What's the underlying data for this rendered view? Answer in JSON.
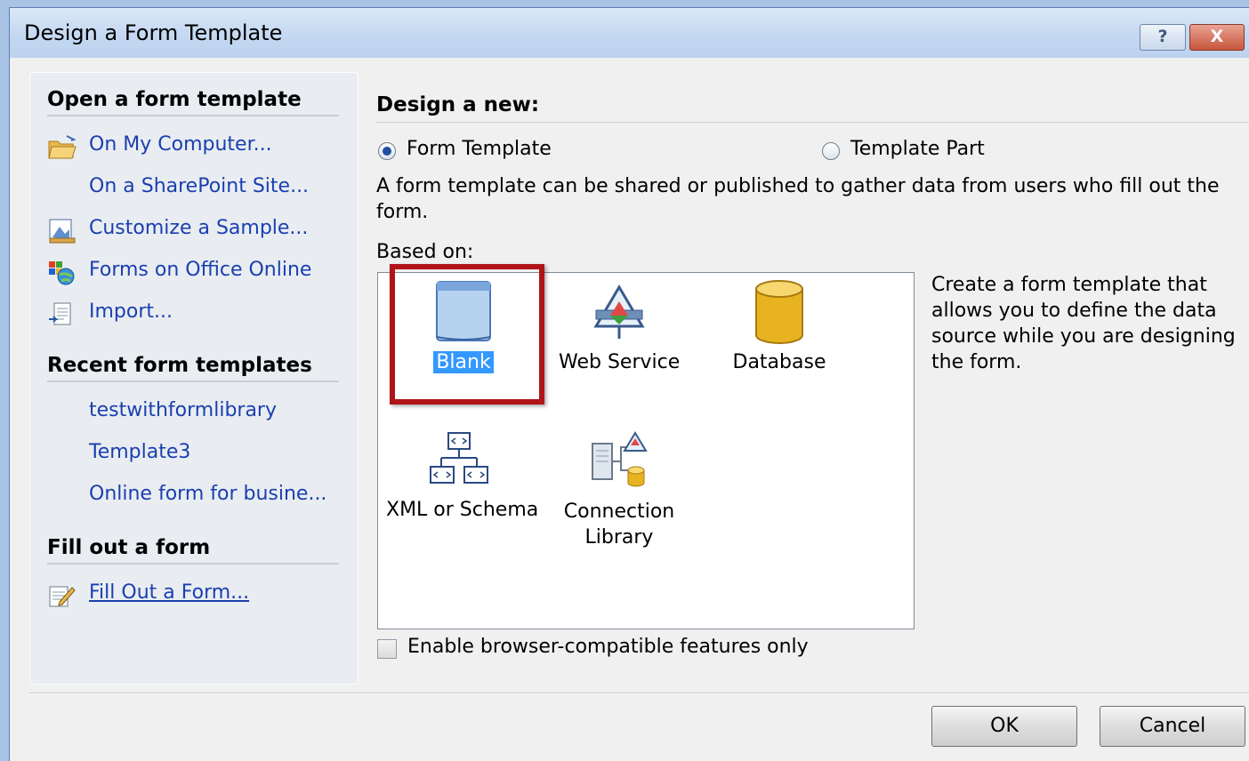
{
  "window": {
    "title": "Design a Form Template",
    "help_glyph": "?",
    "close_glyph": "X"
  },
  "left_pane": {
    "open_section": "Open a form template",
    "open_links": [
      {
        "label": "On My Computer...",
        "icon": "open-folder-icon"
      },
      {
        "label": "On a SharePoint Site...",
        "icon": ""
      },
      {
        "label": "Customize a Sample...",
        "icon": "sample-form-icon"
      },
      {
        "label": "Forms on Office Online",
        "icon": "office-online-globe-icon"
      },
      {
        "label": "Import...",
        "icon": "import-icon"
      }
    ],
    "recent_section": "Recent form templates",
    "recent_items": [
      "testwithformlibrary",
      "Template3",
      "Online form for busine..."
    ],
    "fill_section": "Fill out a form",
    "fill_link": "Fill Out a Form..."
  },
  "main": {
    "design_new_heading": "Design a new:",
    "radio_form_template": "Form Template",
    "radio_template_part": "Template Part",
    "selected_radio": "Form Template",
    "description": "A form template can be shared or published to gather data from users who fill out the form.",
    "based_on_label": "Based on:",
    "gallery": [
      {
        "label": "Blank",
        "icon": "blank-page-icon",
        "selected": true
      },
      {
        "label": "Web Service",
        "icon": "web-service-icon",
        "selected": false
      },
      {
        "label": "Database",
        "icon": "database-cylinder-icon",
        "selected": false
      },
      {
        "label": "XML or Schema",
        "icon": "xml-schema-icon",
        "selected": false
      },
      {
        "label": "Connection Library",
        "icon": "connection-library-icon",
        "selected": false
      }
    ],
    "selection_description": "Create a form template that allows you to define the data source while you are designing the form.",
    "checkbox_label": "Enable browser-compatible features only",
    "checkbox_checked": false
  },
  "buttons": {
    "ok": "OK",
    "cancel": "Cancel"
  },
  "colors": {
    "highlight_box": "#b01418",
    "selection": "#3399ff",
    "link": "#1a3fb0"
  }
}
